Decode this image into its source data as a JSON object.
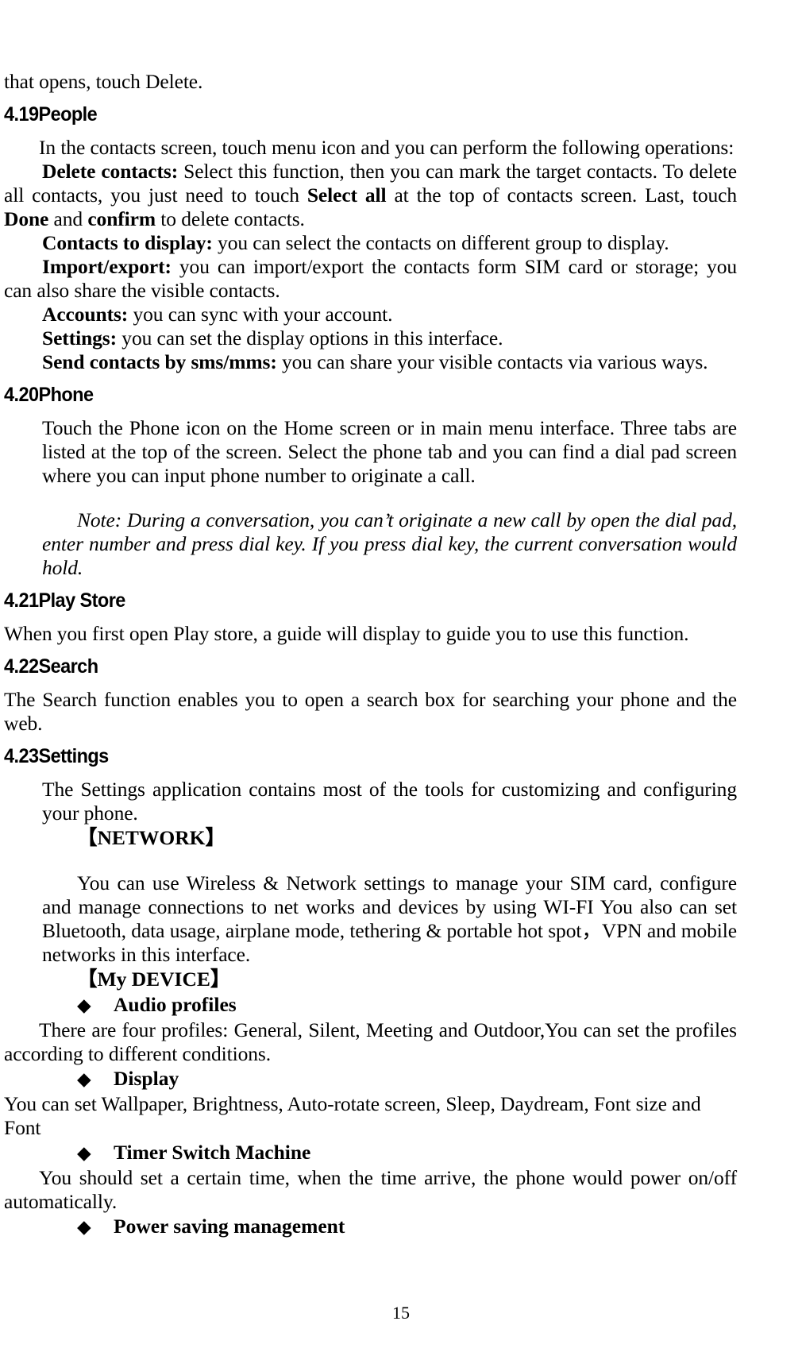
{
  "document": {
    "page_number": "15"
  },
  "body": {
    "intro_line": "that opens, touch Delete.",
    "sections": [
      {
        "heading": "4.19People",
        "paragraphs": {
          "intro": "In the contacts screen, touch menu icon and you can perform the following operations:",
          "delete_contacts_label": "Delete contacts:",
          "delete_contacts_text": " Select this function, then you can mark the target contacts. To delete all contacts, you just need to touch ",
          "delete_contacts_bold2": "Select all",
          "delete_contacts_text2": " at the top of contacts screen. Last, touch ",
          "delete_contacts_bold3": "Done",
          "delete_contacts_text3": " and ",
          "delete_contacts_bold4": "confirm",
          "delete_contacts_text4": " to delete contacts.",
          "contacts_to_display_label": "Contacts to display:",
          "contacts_to_display_text": " you can select the contacts on different group to display.",
          "import_export_label": "Import/export:",
          "import_export_text": " you can import/export the contacts form SIM card or storage; you can also share the visible contacts.",
          "accounts_label": "Accounts:",
          "accounts_text": " you can sync with your account.",
          "settings_label": "Settings:",
          "settings_text": " you can set the display options in this interface.",
          "send_contacts_label": "Send contacts by sms/mms:",
          "send_contacts_text": " you can share your visible contacts via various ways."
        }
      },
      {
        "heading": "4.20Phone",
        "paragraphs": {
          "body": "Touch the Phone icon on the Home screen or in main menu interface. Three tabs are listed at the top of the screen. Select the phone tab and you can find a dial pad screen where you can input phone number to originate a call.",
          "note": "Note: During a conversation, you can’t originate a new call by open the dial pad, enter number and press dial key. If you press dial key, the current conversation would hold."
        }
      },
      {
        "heading": "4.21Play Store",
        "paragraphs": {
          "body": "When you first open  Play store, a guide will display to guide you to use this function."
        }
      },
      {
        "heading": "4.22Search",
        "paragraphs": {
          "body": "The Search function enables you to open a search box for searching your phone and the web."
        }
      },
      {
        "heading": "4.23Settings",
        "paragraphs": {
          "body": "The Settings application contains most of the tools for customizing and configuring your phone.",
          "network_heading": "【NETWORK】",
          "network_body": "You can use Wireless & Network settings to manage your SIM card, configure and manage connections to net works and devices by using WI-FI You also can set Bluetooth, data usage, airplane mode, tethering & portable hot spot，VPN and mobile networks in this interface.",
          "my_device_heading": "【My DEVICE】",
          "bullets": [
            {
              "glyph": "◆",
              "label": "Audio profiles",
              "text": "There are four profiles: General, Silent, Meeting and Outdoor,You can set the profiles according to different conditions."
            },
            {
              "glyph": "◆",
              "label": "Display",
              "text": "You can set Wallpaper, Brightness, Auto-rotate screen, Sleep, Daydream, Font size and Font"
            },
            {
              "glyph": "◆",
              "label": "Timer Switch Machine",
              "text": "You should set a certain time, when the time arrive, the phone would power on/off automatically."
            },
            {
              "glyph": "◆",
              "label": "Power saving management",
              "text": ""
            }
          ]
        }
      }
    ]
  }
}
